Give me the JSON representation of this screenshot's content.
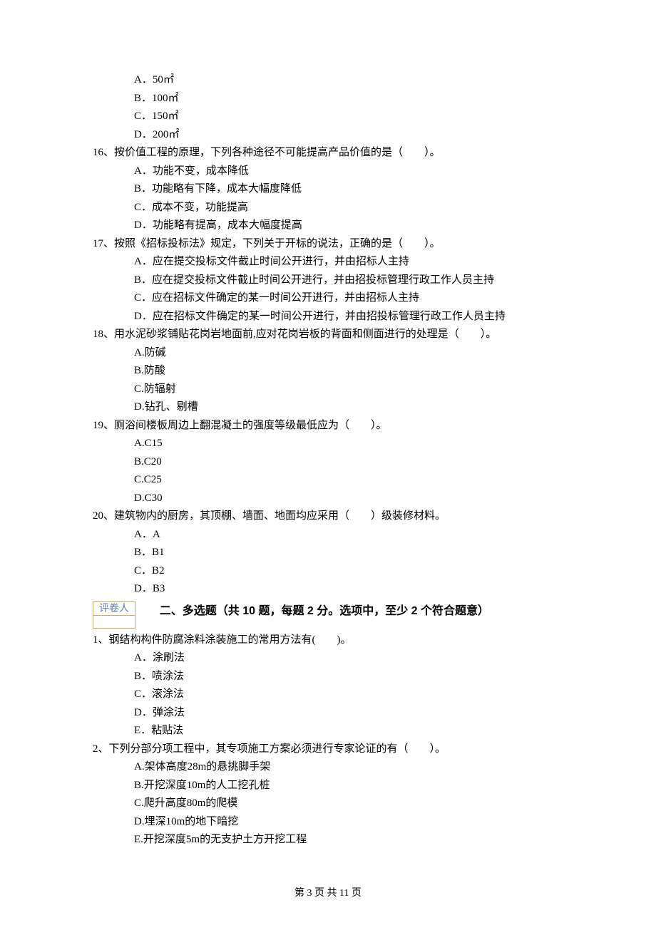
{
  "q15": {
    "optA": "A．50㎡",
    "optB": "B．100㎡",
    "optC": "C．150㎡",
    "optD": "D．200㎡"
  },
  "q16": {
    "stem": "16、按价值工程的原理，下列各种途径不可能提高产品价值的是（　　）。",
    "optA": "A．功能不变，成本降低",
    "optB": "B．功能略有下降，成本大幅度降低",
    "optC": "C．成本不变，功能提高",
    "optD": "D．功能略有提高，成本大幅度提高"
  },
  "q17": {
    "stem": "17、按照《招标投标法》规定，下列关于开标的说法，正确的是（　　）。",
    "optA": "A．应在提交投标文件截止时间公开进行，并由招标人主持",
    "optB": "B．应在提交投标文件截止时间公开进行，并由招投标管理行政工作人员主持",
    "optC": "C．应在招标文件确定的某一时间公开进行，并由招标人主持",
    "optD": "D．应在招标文件确定的某一时间公开进行，并由招投标管理行政工作人员主持"
  },
  "q18": {
    "stem": "18、用水泥砂浆铺贴花岗岩地面前,应对花岗岩板的背面和侧面进行的处理是（　　）。",
    "optA": "A.防碱",
    "optB": "B.防酸",
    "optC": "C.防辐射",
    "optD": "D.钻孔、剔槽"
  },
  "q19": {
    "stem": "19、厕浴间楼板周边上翻混凝土的强度等级最低应为（　　）。",
    "optA": "A.C15",
    "optB": "B.C20",
    "optC": "C.C25",
    "optD": "D.C30"
  },
  "q20": {
    "stem": "20、建筑物内的厨房，其顶棚、墙面、地面均应采用（　　）级装修材料。",
    "optA": "A．A",
    "optB": "B．B1",
    "optC": "C．B2",
    "optD": "D．B3"
  },
  "reviewer": "评卷人",
  "sectionTitle": "二、多选题（共 10 题，每题 2 分。选项中，至少 2 个符合题意）",
  "mq1": {
    "stem": "1、钢结构构件防腐涂料涂装施工的常用方法有(　　)。",
    "optA": "A．涂刷法",
    "optB": "B．喷涂法",
    "optC": "C．滚涂法",
    "optD": "D．弹涂法",
    "optE": "E．粘贴法"
  },
  "mq2": {
    "stem": "2、下列分部分项工程中，其专项施工方案必须进行专家论证的有（　　）。",
    "optA": "A.架体高度28m的悬挑脚手架",
    "optB": "B.开挖深度10m的人工挖孔桩",
    "optC": "C.爬升高度80m的爬模",
    "optD": "D.埋深10m的地下暗挖",
    "optE": "E.开挖深度5m的无支护土方开挖工程"
  },
  "footer": "第 3 页 共 11 页"
}
